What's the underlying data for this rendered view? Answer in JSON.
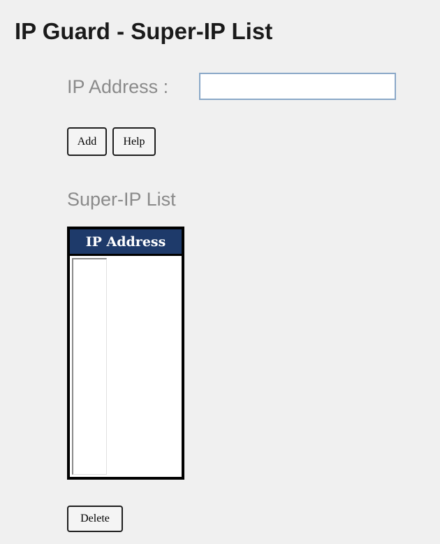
{
  "page": {
    "title": "IP Guard - Super-IP List"
  },
  "form": {
    "ip_label": "IP Address :",
    "ip_value": "",
    "add_label": "Add",
    "help_label": "Help"
  },
  "super_ip_list": {
    "title": "Super-IP List",
    "column_header": "IP Address",
    "entries": [],
    "delete_label": "Delete"
  },
  "colors": {
    "background": "#f0f0f0",
    "header_bg": "#1e3a6a",
    "label_gray": "#8a8a8a",
    "input_border": "#8aa8c8"
  }
}
